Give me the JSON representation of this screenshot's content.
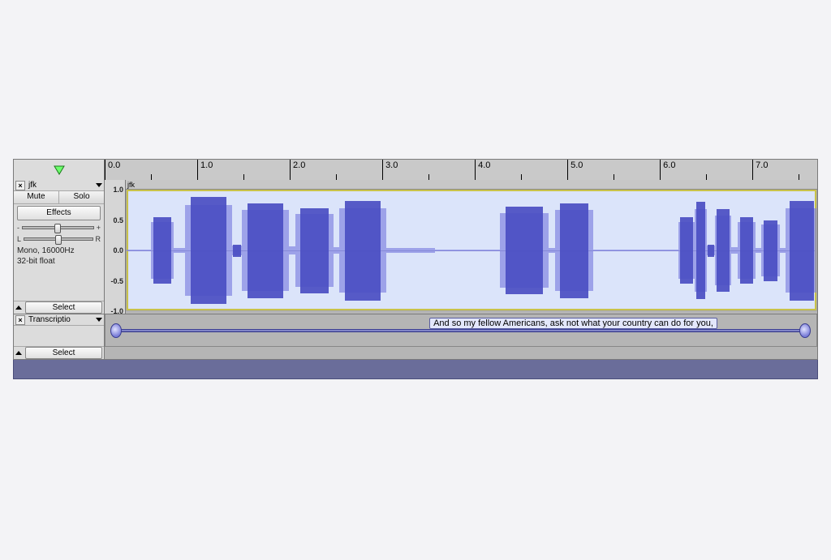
{
  "timeline": {
    "start": 0.0,
    "end": 7.7,
    "major_ticks": [
      "0.0",
      "1.0",
      "2.0",
      "3.0",
      "4.0",
      "5.0",
      "6.0",
      "7.0"
    ]
  },
  "audio_track": {
    "name": "jfk",
    "clip_name": "jfk",
    "mute_label": "Mute",
    "solo_label": "Solo",
    "effects_label": "Effects",
    "gain_min": "-",
    "gain_max": "+",
    "pan_left": "L",
    "pan_right": "R",
    "format_line1": "Mono, 16000Hz",
    "format_line2": "32-bit float",
    "select_label": "Select",
    "amp_scale": [
      "1.0",
      "0.5",
      "0.0",
      "-0.5",
      "-1.0"
    ]
  },
  "label_track": {
    "name": "Transcriptio",
    "select_label": "Select",
    "label_text": "And so my fellow Americans, ask not what your country can do for you,",
    "label_start_sec": 0.115,
    "label_end_sec": 7.56,
    "label_box_start_sec": 3.5
  },
  "colors": {
    "wave_dark": "#4b4ec2",
    "wave_light": "#7c7ee0",
    "clip_bg": "#dbe4fa",
    "selection_outline": "#c9c24a"
  }
}
